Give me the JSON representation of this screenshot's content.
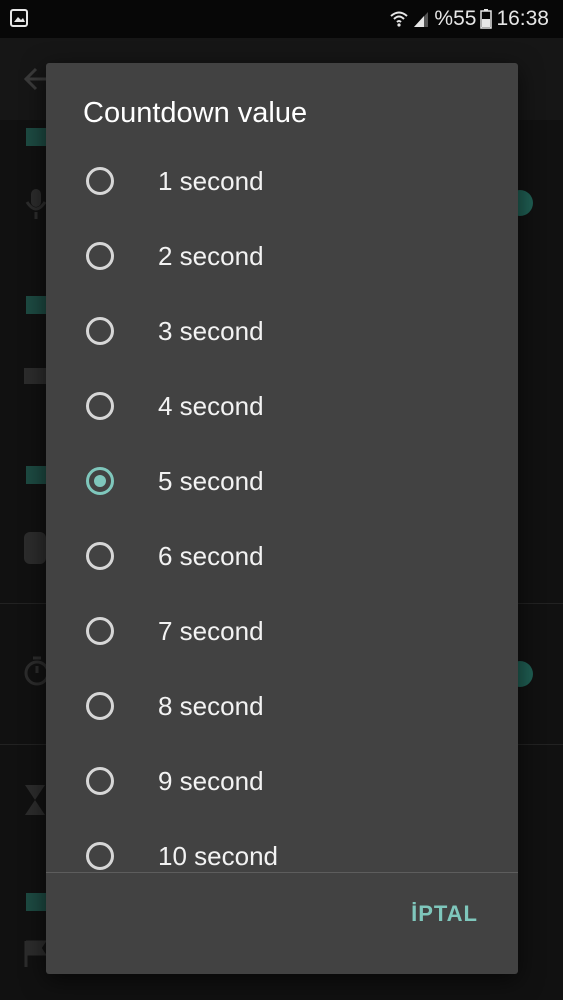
{
  "status_bar": {
    "battery_percent": "%55",
    "time": "16:38"
  },
  "dialog": {
    "title": "Countdown value",
    "options": [
      {
        "label": "1 second",
        "checked": false
      },
      {
        "label": "2 second",
        "checked": false
      },
      {
        "label": "3 second",
        "checked": false
      },
      {
        "label": "4 second",
        "checked": false
      },
      {
        "label": "5 second",
        "checked": true
      },
      {
        "label": "6 second",
        "checked": false
      },
      {
        "label": "7 second",
        "checked": false
      },
      {
        "label": "8 second",
        "checked": false
      },
      {
        "label": "9 second",
        "checked": false
      },
      {
        "label": "10 second",
        "checked": false
      }
    ],
    "cancel_label": "İPTAL"
  },
  "colors": {
    "accent": "#7fc7bc",
    "dialog_background": "#424242",
    "radio_unchecked": "#d7d7d7"
  }
}
